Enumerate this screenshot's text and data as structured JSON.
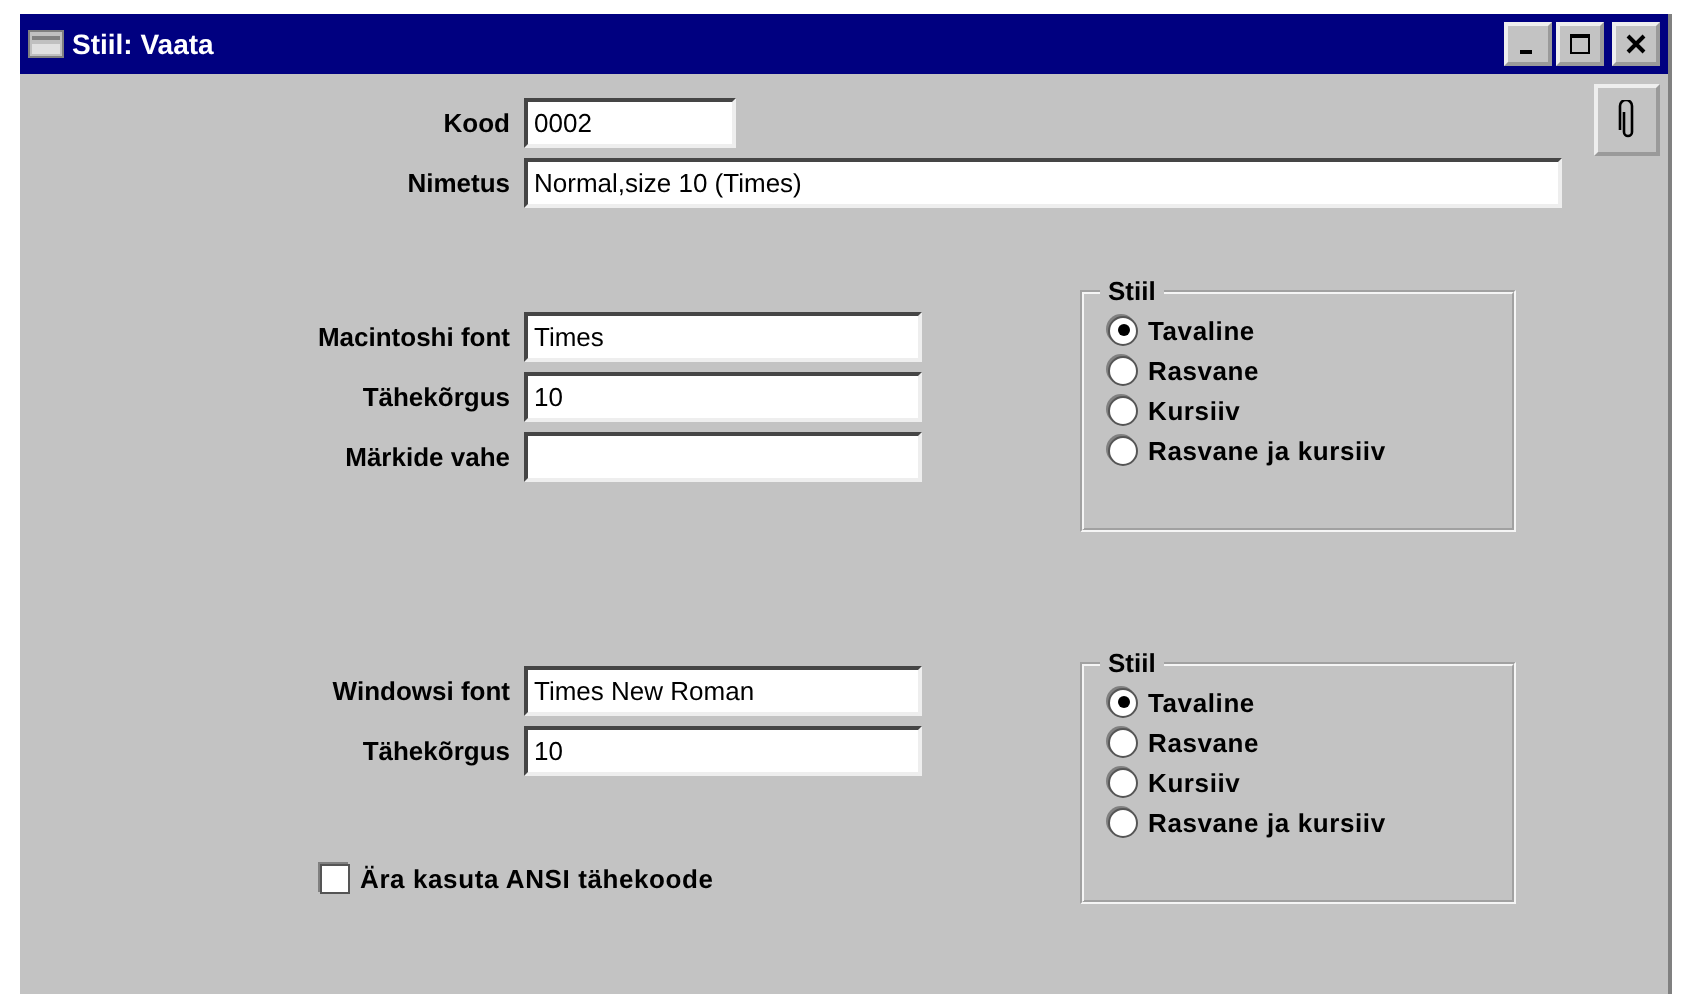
{
  "window": {
    "title": "Stiil: Vaata"
  },
  "header_fields": [
    {
      "label": "Kood",
      "value": "0002",
      "kind": "short"
    },
    {
      "label": "Nimetus",
      "value": "Normal,size 10 (Times)",
      "kind": "long"
    }
  ],
  "sections": [
    {
      "fields": [
        {
          "label": "Macintoshi font",
          "value": "Times"
        },
        {
          "label": "Tähekõrgus",
          "value": "10"
        },
        {
          "label": "Märkide vahe"
        }
      ],
      "style_group": {
        "title": "Stiil",
        "options": [
          {
            "label": "Tavaline",
            "selected": true
          },
          {
            "label": "Rasvane",
            "selected": false
          },
          {
            "label": "Kursiiv",
            "selected": false
          },
          {
            "label": "Rasvane ja kursiiv",
            "selected": false
          }
        ]
      }
    },
    {
      "fields": [
        {
          "label": "Windowsi font",
          "value": "Times New Roman"
        },
        {
          "label": "Tähekõrgus",
          "value": "10"
        }
      ],
      "style_group": {
        "title": "Stiil",
        "options": [
          {
            "label": "Tavaline",
            "selected": true
          },
          {
            "label": "Rasvane",
            "selected": false
          },
          {
            "label": "Kursiiv",
            "selected": false
          },
          {
            "label": "Rasvane ja kursiiv",
            "selected": false
          }
        ]
      }
    }
  ],
  "checkbox": {
    "label": "Ära kasuta ANSI tähekoode",
    "checked": false
  }
}
